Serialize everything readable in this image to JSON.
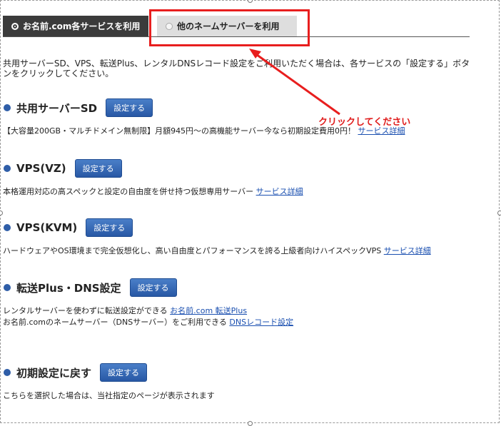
{
  "tabs": [
    {
      "label": "お名前.com各サービスを利用",
      "active": true
    },
    {
      "label": "他のネームサーバーを利用",
      "active": false
    }
  ],
  "intro_text": "共用サーバーSD、VPS、転送Plus、レンタルDNSレコード設定をご利用いただく場合は、各サービスの「設定する」ボタンをクリックしてください。",
  "callout_text": "クリックしてください",
  "setup_button_label": "設定する",
  "sections": [
    {
      "title": "共用サーバーSD",
      "lines": [
        {
          "text": "【大容量200GB・マルチドメイン無制限】月額945円〜の高機能サーバー今なら初期設定費用0円！ ",
          "link": "サービス詳細"
        }
      ]
    },
    {
      "title": "VPS(VZ)",
      "lines": [
        {
          "text": "本格運用対応の高スペックと設定の自由度を併せ持つ仮想専用サーバー ",
          "link": "サービス詳細"
        }
      ]
    },
    {
      "title": "VPS(KVM)",
      "lines": [
        {
          "text": "ハードウェアやOS環境まで完全仮想化し、高い自由度とパフォーマンスを誇る上級者向けハイスペックVPS ",
          "link": "サービス詳細"
        }
      ]
    },
    {
      "title": "転送Plus・DNS設定",
      "lines": [
        {
          "text": "レンタルサーバーを使わずに転送設定ができる ",
          "link": "お名前.com 転送Plus"
        },
        {
          "text": "お名前.comのネームサーバー（DNSサーバー）をご利用できる ",
          "link": "DNSレコード設定"
        }
      ]
    },
    {
      "title": "初期設定に戻す",
      "lines": [
        {
          "text": "こちらを選択した場合は、当社指定のページが表示されます",
          "link": ""
        }
      ]
    }
  ],
  "colors": {
    "accent_blue": "#2f5ea8",
    "callout_red": "#e01c1c",
    "tab_dark": "#3b3b3b"
  }
}
